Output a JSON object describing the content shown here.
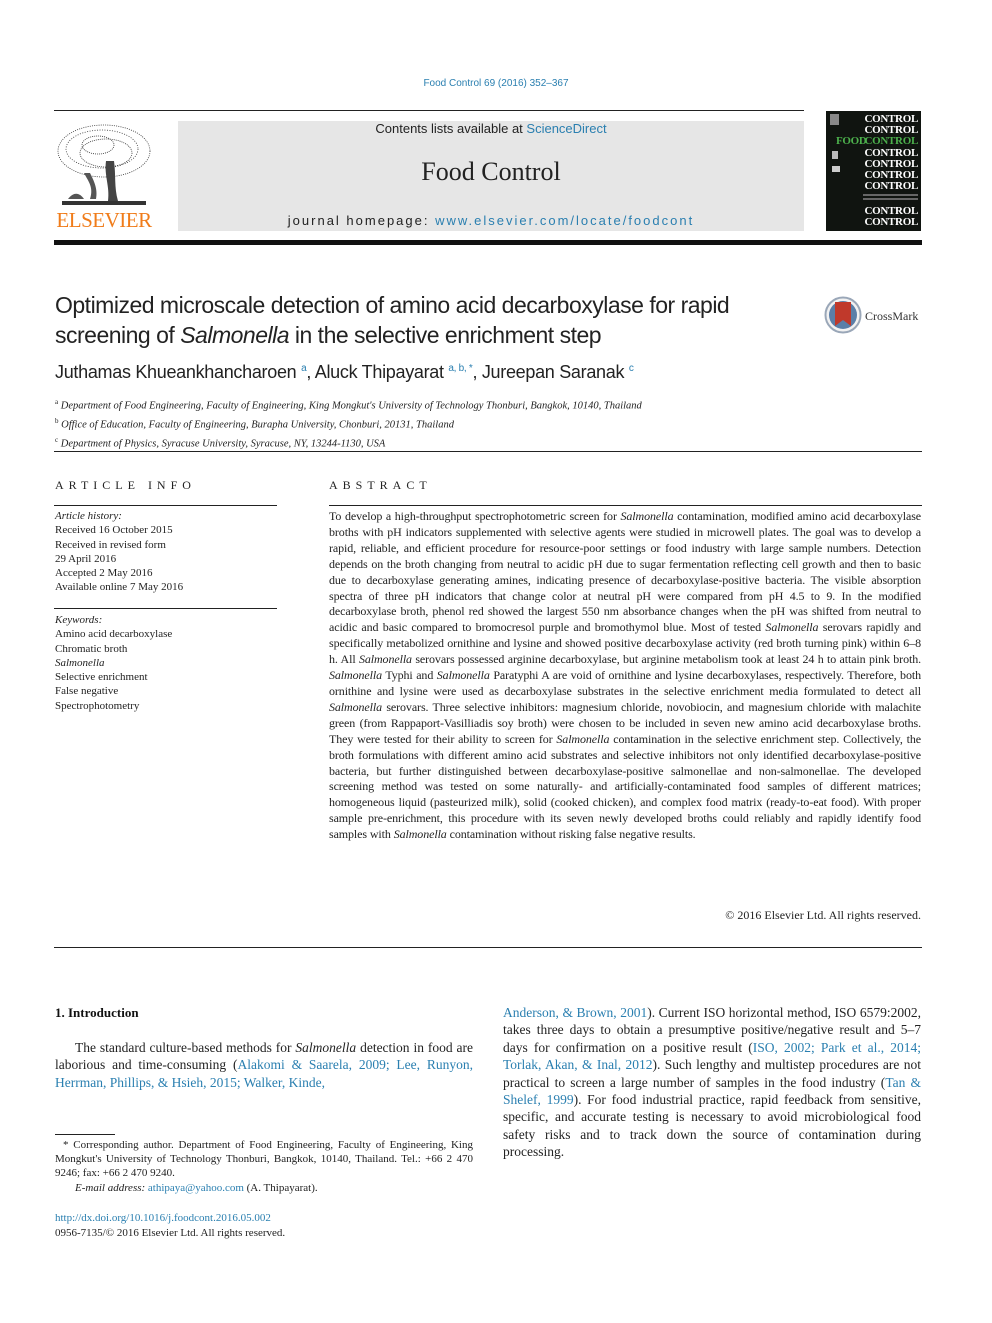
{
  "header": {
    "citation": "Food Control 69 (2016) 352–367",
    "contents_prefix": "Contents lists available at ",
    "contents_link": "ScienceDirect",
    "journal_title": "Food Control",
    "homepage_prefix": "journal homepage: ",
    "homepage_link": "www.elsevier.com/locate/foodcont",
    "publisher_logo_text": "ELSEVIER",
    "cover": {
      "rows": [
        "CONTROL",
        "CONTROL",
        "CONTROL",
        "CONTROL",
        "CONTROL",
        "CONTROL",
        "CONTROL",
        "CONTROL",
        "CONTROL"
      ],
      "food_word": "FOOD"
    },
    "brand_colors": {
      "elsevier_orange": "#f07c1a",
      "link_blue": "#2a7fb0",
      "cover_green": "#4cb04c"
    }
  },
  "article": {
    "title_line1": "Optimized microscale detection of amino acid decarboxylase for rapid",
    "title_line2_pre": "screening of ",
    "title_line2_italic": "Salmonella",
    "title_line2_post": " in the selective enrichment step",
    "crossmark_label": "CrossMark",
    "authors": [
      {
        "name": "Juthamas Khueankhancharoen",
        "sup": "a",
        "sep": ", "
      },
      {
        "name": "Aluck Thipayarat",
        "sup": "a, b, *",
        "sep": ", "
      },
      {
        "name": "Jureepan Saranak",
        "sup": "c",
        "sep": ""
      }
    ],
    "affiliations": [
      {
        "mark": "a",
        "text": "Department of Food Engineering, Faculty of Engineering, King Mongkut's University of Technology Thonburi, Bangkok, 10140, Thailand"
      },
      {
        "mark": "b",
        "text": "Office of Education, Faculty of Engineering, Burapha University, Chonburi, 20131, Thailand"
      },
      {
        "mark": "c",
        "text": "Department of Physics, Syracuse University, Syracuse, NY, 13244-1130, USA"
      }
    ]
  },
  "article_info": {
    "heading": "ARTICLE INFO",
    "history_label": "Article history:",
    "history": [
      "Received 16 October 2015",
      "Received in revised form",
      "29 April 2016",
      "Accepted 2 May 2016",
      "Available online 7 May 2016"
    ],
    "keywords_label": "Keywords:",
    "keywords": [
      "Amino acid decarboxylase",
      "Chromatic broth",
      "Salmonella",
      "Selective enrichment",
      "False negative",
      "Spectrophotometry"
    ]
  },
  "abstract": {
    "heading": "ABSTRACT",
    "segments": [
      {
        "t": "To develop a high-throughput spectrophotometric screen for "
      },
      {
        "t": "Salmonella",
        "i": true
      },
      {
        "t": " contamination, modified amino acid decarboxylase broths with pH indicators supplemented with selective agents were studied in microwell plates. The goal was to develop a rapid, reliable, and efficient procedure for resource-poor settings or food industry with large sample numbers. Detection depends on the broth changing from neutral to acidic pH due to sugar fermentation reflecting cell growth and then to basic due to decarboxylase generating amines, indicating presence of decarboxylase-positive bacteria. The visible absorption spectra of three pH indicators that change color at neutral pH were compared from pH 4.5 to 9. In the modified decarboxylase broth, phenol red showed the largest 550 nm absorbance changes when the pH was shifted from neutral to acidic and basic compared to bromocresol purple and bromothymol blue. Most of tested "
      },
      {
        "t": "Salmonella",
        "i": true
      },
      {
        "t": " serovars rapidly and specifically metabolized ornithine and lysine and showed positive decarboxylase activity (red broth turning pink) within 6–8 h. All "
      },
      {
        "t": "Salmonella",
        "i": true
      },
      {
        "t": " serovars possessed arginine decarboxylase, but arginine metabolism took at least 24 h to attain pink broth. "
      },
      {
        "t": "Salmonella",
        "i": true
      },
      {
        "t": " Typhi and "
      },
      {
        "t": "Salmonella",
        "i": true
      },
      {
        "t": " Paratyphi A are void of ornithine and lysine decarboxylases, respectively. Therefore, both ornithine and lysine were used as decarboxylase substrates in the selective enrichment media formulated to detect all "
      },
      {
        "t": "Salmonella",
        "i": true
      },
      {
        "t": " serovars. Three selective inhibitors: magnesium chloride, novobiocin, and magnesium chloride with malachite green (from Rappaport-Vasilliadis soy broth) were chosen to be included in seven new amino acid decarboxylase broths. They were tested for their ability to screen for "
      },
      {
        "t": "Salmonella",
        "i": true
      },
      {
        "t": " contamination in the selective enrichment step. Collectively, the broth formulations with different amino acid substrates and selective inhibitors not only identified decarboxylase-positive bacteria, but further distinguished between decarboxylase-positive salmonellae and non-salmonellae. The developed screening method was tested on some naturally- and artificially-contaminated food samples of different matrices; homogeneous liquid (pasteurized milk), solid (cooked chicken), and complex food matrix (ready-to-eat food). With proper sample pre-enrichment, this procedure with its seven newly developed broths could reliably and rapidly identify food samples with "
      },
      {
        "t": "Salmonella",
        "i": true
      },
      {
        "t": " contamination without risking false negative results."
      }
    ],
    "copyright": "© 2016 Elsevier Ltd. All rights reserved."
  },
  "introduction": {
    "heading": "1.  Introduction",
    "left_segments": [
      {
        "t": "The standard culture-based methods for "
      },
      {
        "t": "Salmonella",
        "i": true
      },
      {
        "t": " detection in food are laborious and time-consuming ("
      },
      {
        "t": "Alakomi & Saarela, 2009; Lee, Runyon, Herrman, Phillips, & Hsieh, 2015; Walker, Kinde,",
        "link": true
      }
    ],
    "right_segments": [
      {
        "t": "Anderson, & Brown, 2001",
        "link": true
      },
      {
        "t": "). Current ISO horizontal method, ISO 6579:2002, takes three days to obtain a presumptive positive/negative result and 5–7 days for confirmation on a positive result ("
      },
      {
        "t": "ISO, 2002; Park et al., 2014; Torlak, Akan, & Inal, 2012",
        "link": true
      },
      {
        "t": "). Such lengthy and multistep procedures are not practical to screen a large number of samples in the food industry ("
      },
      {
        "t": "Tan & Shelef, 1999",
        "link": true
      },
      {
        "t": "). For food industrial practice, rapid feedback from sensitive, specific, and accurate testing is necessary to avoid microbiological food safety risks and to track down the source of contamination during processing."
      }
    ]
  },
  "footnote": {
    "corresponding": "* Corresponding author. Department of Food Engineering, Faculty of Engineering, King Mongkut's University of Technology Thonburi, Bangkok, 10140, Thailand. Tel.: +66 2 470 9246; fax: +66 2 470 9240.",
    "email_label": "E-mail address: ",
    "email": "athipaya@yahoo.com",
    "email_suffix": " (A. Thipayarat).",
    "doi": "http://dx.doi.org/10.1016/j.foodcont.2016.05.002",
    "issn": "0956-7135/© 2016 Elsevier Ltd. All rights reserved."
  }
}
